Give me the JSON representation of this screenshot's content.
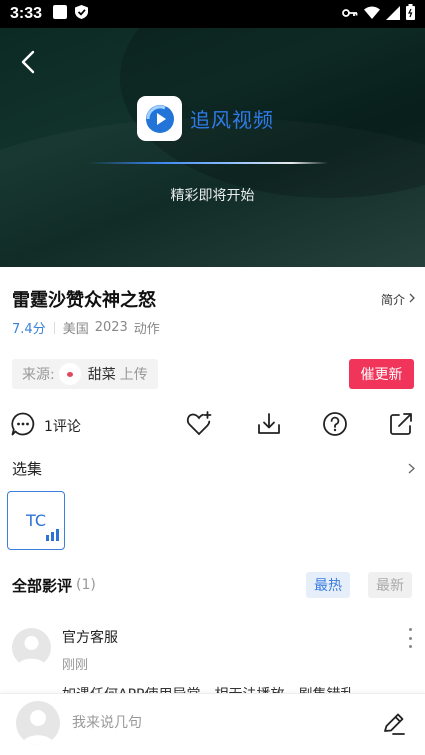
{
  "status_bar": {
    "time": "3:33"
  },
  "player": {
    "brand_name": "追风视频",
    "loading_text": "精彩即将开始"
  },
  "movie": {
    "title": "雷霆沙赞众神之怒",
    "intro_label": "简介",
    "score": "7.4分",
    "region": "美国",
    "year": "2023",
    "genre": "动作"
  },
  "source": {
    "label": "来源:",
    "uploader": "甜菜",
    "action": "上传",
    "update_button": "催更新"
  },
  "actions": {
    "comment_count": "1评论",
    "icons": [
      "comment-icon",
      "favorite-add-icon",
      "download-icon",
      "help-icon",
      "share-icon"
    ]
  },
  "episodes": {
    "title": "选集",
    "items": [
      {
        "label": "TC"
      }
    ]
  },
  "reviews": {
    "title": "全部影评",
    "count": "(1)",
    "sort_hot": "最热",
    "sort_new": "最新",
    "items": [
      {
        "name": "官方客服",
        "time": "刚刚",
        "text": "如遇任何APP使用异常、相无法播放、剧集错乱"
      }
    ]
  },
  "bottom_bar": {
    "placeholder": "我来说几句"
  },
  "colors": {
    "accent_blue": "#3a7ee0",
    "update_red": "#f0345a",
    "player_bg": "#12322c"
  }
}
